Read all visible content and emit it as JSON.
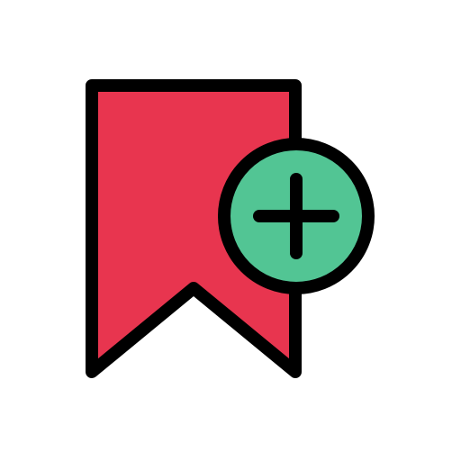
{
  "icon": {
    "name": "bookmark-add-icon",
    "bookmark_color": "#E8354F",
    "badge_color": "#52C594",
    "outline_color": "#000000",
    "background_color": "#FFFFFF"
  }
}
